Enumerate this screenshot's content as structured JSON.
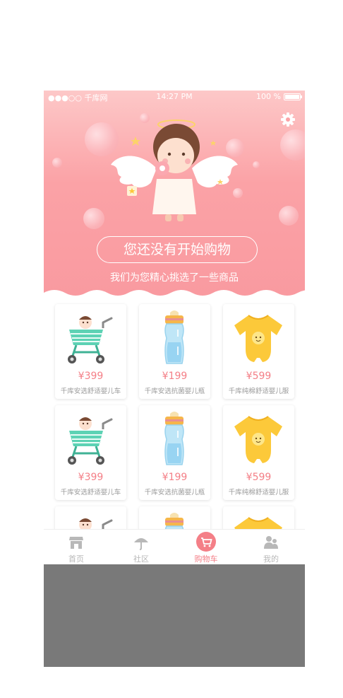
{
  "status_bar": {
    "carrier": "●●●○○ 千库网",
    "time": "14:27 PM",
    "battery": "100 %"
  },
  "header": {
    "cta_label": "您还没有开始购物",
    "subtitle": "我们为您精心挑选了一些商品"
  },
  "icons": {
    "settings": "gear-icon",
    "home": "storefront-icon",
    "community": "umbrella-icon",
    "cart": "cart-icon",
    "mine": "people-icon"
  },
  "colors": {
    "accent": "#f47f87",
    "hero": "#fba2a6",
    "teal": "#5dd2b4",
    "yellow": "#fcc93a"
  },
  "products": [
    {
      "price": "¥399",
      "name": "千库安选舒适婴儿车",
      "kind": "stroller"
    },
    {
      "price": "¥199",
      "name": "千库安选抗菌婴儿瓶",
      "kind": "bottle"
    },
    {
      "price": "¥599",
      "name": "千库纯棉舒适婴儿服",
      "kind": "onesie"
    },
    {
      "price": "¥399",
      "name": "千库安选舒适婴儿车",
      "kind": "stroller"
    },
    {
      "price": "¥199",
      "name": "千库安选抗菌婴儿瓶",
      "kind": "bottle"
    },
    {
      "price": "¥599",
      "name": "千库纯棉舒适婴儿服",
      "kind": "onesie"
    },
    {
      "price": "",
      "name": "",
      "kind": "stroller"
    },
    {
      "price": "",
      "name": "",
      "kind": "bottle"
    },
    {
      "price": "",
      "name": "",
      "kind": "onesie"
    }
  ],
  "tabs": [
    {
      "label": "首页",
      "icon": "storefront-icon",
      "active": false
    },
    {
      "label": "社区",
      "icon": "umbrella-icon",
      "active": false
    },
    {
      "label": "购物车",
      "icon": "cart-icon",
      "active": true
    },
    {
      "label": "我的",
      "icon": "people-icon",
      "active": false
    }
  ]
}
